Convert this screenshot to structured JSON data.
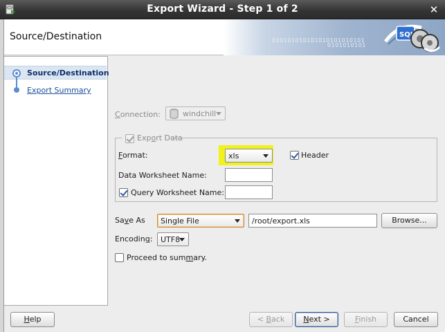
{
  "window": {
    "title": "Export Wizard - Step 1 of 2"
  },
  "header": {
    "title": "Source/Destination",
    "binary_text_1": "010101010101010101010101",
    "binary_text_2": "0101010101",
    "logo_text": "SQL"
  },
  "nav": {
    "items": [
      {
        "label": "Source/Destination",
        "selected": true
      },
      {
        "label": "Export Summary",
        "selected": false
      }
    ]
  },
  "form": {
    "connection": {
      "label_prefix": "",
      "label_u": "C",
      "label_rest": "onnection:",
      "value": "windchill"
    },
    "export_data": {
      "label_pre": "Exp",
      "label_u": "o",
      "label_post": "rt Data",
      "checked": true
    },
    "format": {
      "label_u": "F",
      "label_rest": "ormat:",
      "value": "xls"
    },
    "header_check": {
      "label": "Header",
      "checked": true
    },
    "data_worksheet": {
      "label": "Data Worksheet Name:",
      "value": ""
    },
    "query_worksheet": {
      "label": "Query Worksheet Name:",
      "checked": true,
      "value": ""
    },
    "save_as": {
      "label_pre": "Sa",
      "label_u": "v",
      "label_post": "e As",
      "value": "Single File",
      "path": "/root/export.xls",
      "browse_label": "Browse..."
    },
    "encoding": {
      "label_pre": "Encodin",
      "label_u": "g",
      "label_post": ":",
      "value": "UTF8"
    },
    "proceed": {
      "label_pre": "Proceed to sum",
      "label_u": "m",
      "label_post": "ary.",
      "checked": false
    }
  },
  "buttons": {
    "help": {
      "label_u": "H",
      "label_rest": "elp"
    },
    "back": {
      "label_pre": "< ",
      "label_u": "B",
      "label_rest": "ack"
    },
    "next": {
      "label_u": "N",
      "label_rest": "ext >"
    },
    "finish": {
      "label_u": "F",
      "label_rest": "inish"
    },
    "cancel": {
      "label": "Cancel"
    }
  },
  "colors": {
    "highlight": "#f0f21a",
    "accent": "#5c8bd0",
    "title_bar": "#353535"
  }
}
